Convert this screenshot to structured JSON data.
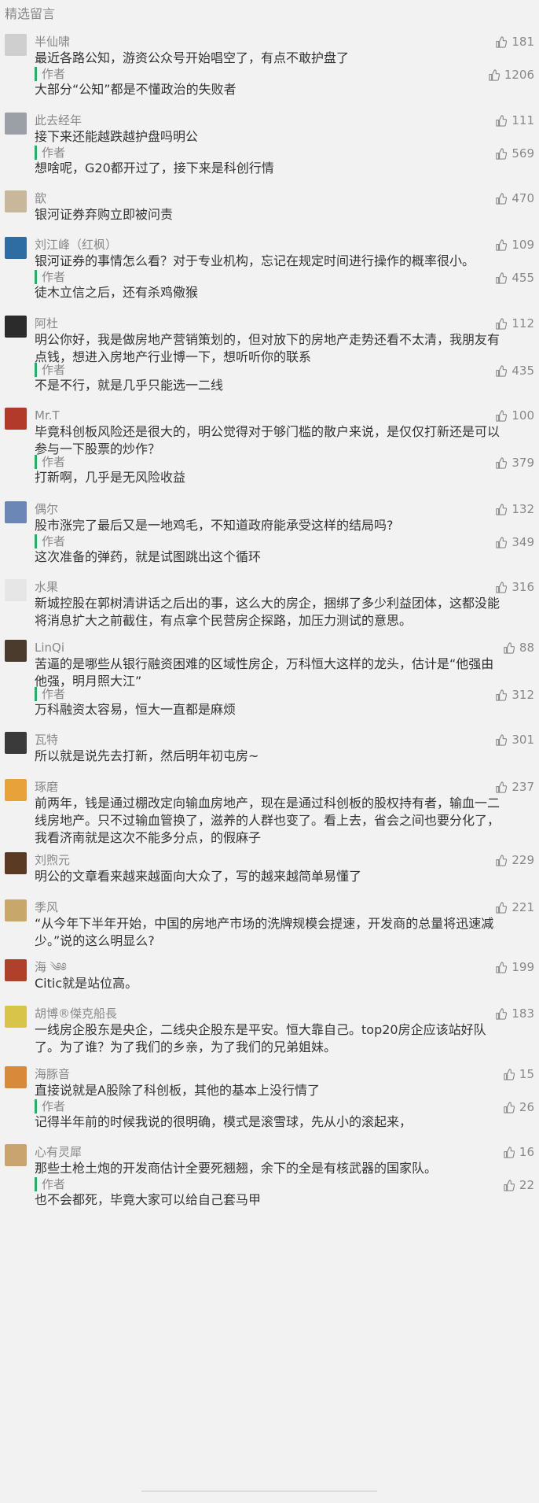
{
  "section_title": "精选留言",
  "author_tag": "作者",
  "comments": [
    {
      "nick": "半仙啸",
      "likes": "181",
      "text": "最近各路公知，游资公众号开始唱空了，有点不敢护盘了",
      "reply_likes": "1206",
      "reply": "大部分“公知”都是不懂政治的失败者",
      "avatar_color": "#cfcfcf"
    },
    {
      "nick": "此去经年",
      "likes": "111",
      "text": "接下来还能越跌越护盘吗明公",
      "reply_likes": "569",
      "reply": "想啥呢，G20都开过了，接下来是科创行情",
      "avatar_color": "#9aa0a6"
    },
    {
      "nick": "歆",
      "likes": "470",
      "text": "银河证券弃购立即被问责",
      "reply_likes": "",
      "reply": "",
      "avatar_color": "#c9b79c"
    },
    {
      "nick": "刘江峰（红枫）",
      "likes": "109",
      "text": "银河证券的事情怎么看？对于专业机构，忘记在规定时间进行操作的概率很小。",
      "reply_likes": "455",
      "reply": "徒木立信之后，还有杀鸡儆猴",
      "avatar_color": "#2e6da4"
    },
    {
      "nick": "阿杜",
      "likes": "112",
      "text": "明公你好，我是做房地产营销策划的，但对放下的房地产走势还看不太清，我朋友有点钱，想进入房地产行业博一下，想听听你的联系",
      "reply_likes": "435",
      "reply": "不是不行，就是几乎只能选一二线",
      "avatar_color": "#2b2b2b"
    },
    {
      "nick": "Mr.T",
      "likes": "100",
      "text": "毕竟科创板风险还是很大的，明公觉得对于够门槛的散户来说，是仅仅打新还是可以参与一下股票的炒作？",
      "reply_likes": "379",
      "reply": "打新啊，几乎是无风险收益",
      "avatar_color": "#b23a2a"
    },
    {
      "nick": "偶尔",
      "likes": "132",
      "text": "股市涨完了最后又是一地鸡毛，不知道政府能承受这样的结局吗?",
      "reply_likes": "349",
      "reply": "这次准备的弹药，就是试图跳出这个循环",
      "avatar_color": "#6a87b5"
    },
    {
      "nick": "水果",
      "likes": "316",
      "text": "新城控股在郭树清讲话之后出的事，这么大的房企，捆绑了多少利益团体，这都没能将消息扩大之前截住，有点拿个民营房企探路，加压力测试的意思。",
      "reply_likes": "",
      "reply": "",
      "avatar_color": "#e6e6e6"
    },
    {
      "nick": "LinQi",
      "likes": "88",
      "text": "苦逼的是哪些从银行融资困难的区域性房企，万科恒大这样的龙头，估计是“他强由他强，明月照大江”",
      "reply_likes": "312",
      "reply": "万科融资太容易，恒大一直都是麻烦",
      "avatar_color": "#4a3b2c"
    },
    {
      "nick": "瓦特",
      "likes": "301",
      "text": "所以就是说先去打新，然后明年初屯房~",
      "reply_likes": "",
      "reply": "",
      "avatar_color": "#3a3a3a"
    },
    {
      "nick": "琢磨",
      "likes": "237",
      "text": "前两年，钱是通过棚改定向输血房地产，现在是通过科创板的股权持有者，输血一二线房地产。只不过输血管换了，滋养的人群也变了。看上去，省会之间也要分化了，我看济南就是这次不能多分点，的假麻子",
      "reply_likes": "",
      "reply": "",
      "avatar_color": "#e8a23a"
    },
    {
      "nick": "刘煦元",
      "likes": "229",
      "text": "明公的文章看来越来越面向大众了，写的越来越简单易懂了",
      "reply_likes": "",
      "reply": "",
      "avatar_color": "#5a3a22"
    },
    {
      "nick": "季风",
      "likes": "221",
      "text": "“从今年下半年开始，中国的房地产市场的洗牌规模会提速，开发商的总量将迅速减少。”说的这么明显么?",
      "reply_likes": "",
      "reply": "",
      "avatar_color": "#c8a86a"
    },
    {
      "nick": "海 ༄༅",
      "likes": "199",
      "text": "Citic就是站位高。",
      "reply_likes": "",
      "reply": "",
      "avatar_color": "#b0402a"
    },
    {
      "nick": "胡博®傑克船長",
      "likes": "183",
      "text": "一线房企股东是央企，二线央企股东是平安。恒大靠自己。top20房企应该站好队了。为了谁？为了我们的乡亲，为了我们的兄弟姐妹。",
      "reply_likes": "",
      "reply": "",
      "avatar_color": "#d9c44a"
    },
    {
      "nick": "海豚音",
      "likes": "15",
      "text": "直接说就是A股除了科创板，其他的基本上没行情了",
      "reply_likes": "26",
      "reply": "记得半年前的时候我说的很明确，模式是滚雪球，先从小的滚起来，",
      "avatar_color": "#d88a3a"
    },
    {
      "nick": "心有灵犀",
      "likes": "16",
      "text": "那些土枪土炮的开发商估计全要死翘翘，余下的全是有核武器的国家队。",
      "reply_likes": "22",
      "reply": "也不会都死，毕竟大家可以给自己套马甲",
      "avatar_color": "#c9a46e"
    }
  ]
}
